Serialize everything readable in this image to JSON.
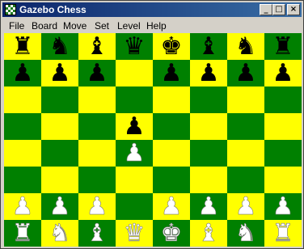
{
  "window": {
    "title": "Gazebo Chess",
    "buttons": {
      "minimize": "_",
      "maximize": "□",
      "close": "×"
    }
  },
  "menu": [
    "File",
    "Board",
    "Move",
    "Set",
    "Level",
    "Help"
  ],
  "board": {
    "light_color": "#ffff00",
    "dark_color": "#008000",
    "rows": [
      [
        "br",
        "bn",
        "bb",
        "bq",
        "bk",
        "bb",
        "bn",
        "br"
      ],
      [
        "bp",
        "bp",
        "bp",
        "",
        "bp",
        "bp",
        "bp",
        "bp"
      ],
      [
        "",
        "",
        "",
        "",
        "",
        "",
        "",
        ""
      ],
      [
        "",
        "",
        "",
        "bp",
        "",
        "",
        "",
        ""
      ],
      [
        "",
        "",
        "",
        "wp",
        "",
        "",
        "",
        ""
      ],
      [
        "",
        "",
        "",
        "",
        "",
        "",
        "",
        ""
      ],
      [
        "wp",
        "wp",
        "wp",
        "",
        "wp",
        "wp",
        "wp",
        "wp"
      ],
      [
        "wr",
        "wn",
        "wb",
        "wq",
        "wk",
        "wb",
        "wn",
        "wr"
      ]
    ]
  },
  "piece_glyphs": {
    "p": "♟",
    "r": "♜",
    "n": "♞",
    "b": "♝",
    "q": "♛",
    "k": "♚"
  }
}
